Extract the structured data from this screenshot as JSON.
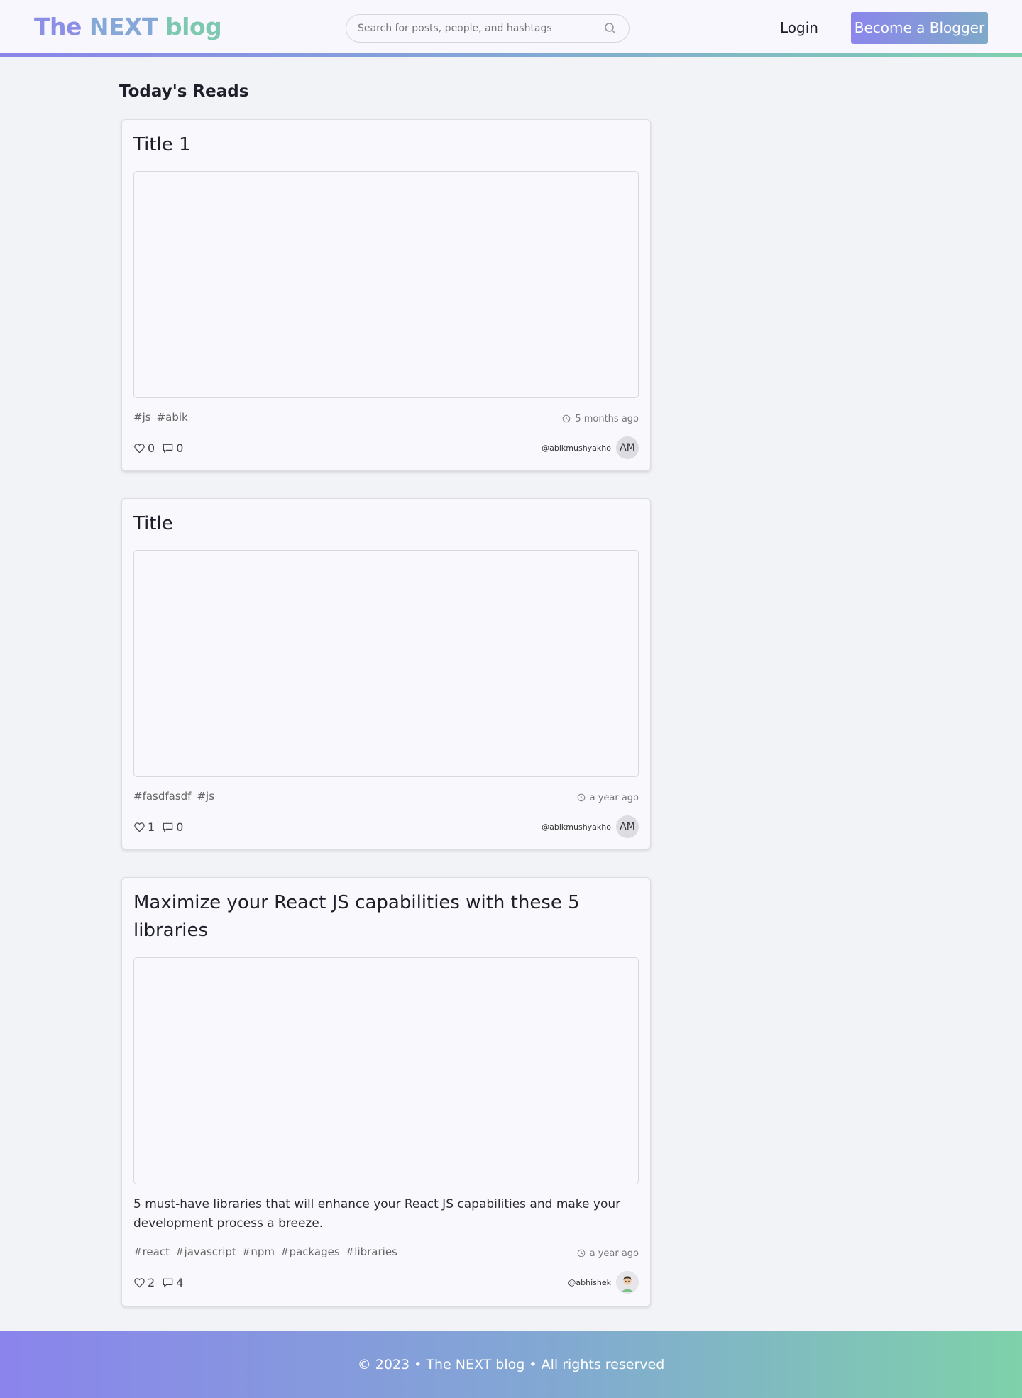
{
  "header": {
    "logo": {
      "part1": "The",
      "part2": "NEXT",
      "part3": "blog"
    },
    "search": {
      "placeholder": "Search for posts, people, and hashtags",
      "value": ""
    },
    "login_label": "Login",
    "cta_label": "Become a Blogger"
  },
  "main": {
    "section_title": "Today's Reads",
    "posts": [
      {
        "title": "Title 1",
        "description": "",
        "tags": [
          "#js",
          "#abik"
        ],
        "time": "5 months ago",
        "likes": "0",
        "comments": "0",
        "author_handle": "@abikmushyakho",
        "author_initials": "AM"
      },
      {
        "title": "Title",
        "description": "",
        "tags": [
          "#fasdfasdf",
          "#js"
        ],
        "time": "a year ago",
        "likes": "1",
        "comments": "0",
        "author_handle": "@abikmushyakho",
        "author_initials": "AM"
      },
      {
        "title": "Maximize your React JS capabilities with these 5 libraries",
        "description": "5 must-have libraries that will enhance your React JS capabilities and make your development process a breeze.",
        "tags": [
          "#react",
          "#javascript",
          "#npm",
          "#packages",
          "#libraries"
        ],
        "time": "a year ago",
        "likes": "2",
        "comments": "4",
        "author_handle": "@abhishek",
        "author_initials": ""
      }
    ]
  },
  "footer": {
    "text": "© 2023 • The NEXT blog • All rights reserved"
  },
  "colors": {
    "accent_start": "#8b84ea",
    "accent_mid": "#82a8d6",
    "accent_end": "#7ecfae",
    "page_bg": "#f2f3f7",
    "card_bg": "#f9f8fd"
  },
  "icons": {
    "search": "search-icon",
    "clock": "clock-icon",
    "like": "heart-icon",
    "comment": "comment-icon"
  }
}
